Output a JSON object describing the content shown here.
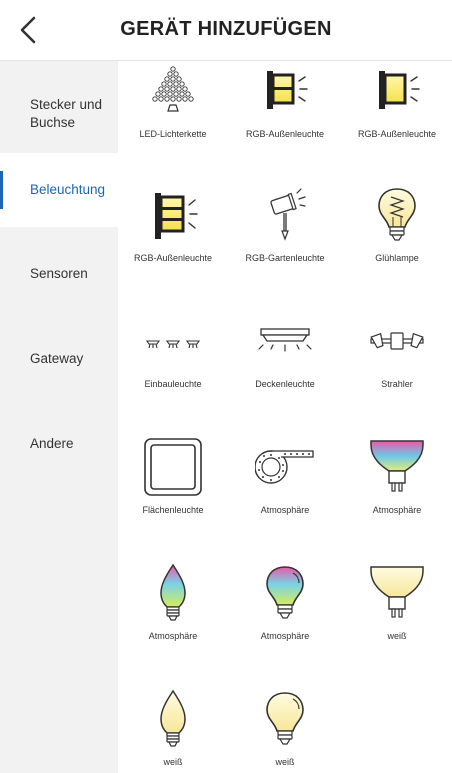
{
  "header": {
    "title": "GERÄT HINZUFÜGEN",
    "back_icon": "chevron-left-icon"
  },
  "sidebar": {
    "active_color": "#1a66b8",
    "items": [
      {
        "label": "Stecker und\nBuchse",
        "active": false
      },
      {
        "label": "Beleuchtung",
        "active": true
      },
      {
        "label": "Sensoren",
        "active": false
      },
      {
        "label": "Gateway",
        "active": false
      },
      {
        "label": "Andere",
        "active": false
      }
    ]
  },
  "devices": [
    {
      "label": "LED-Lichterkette",
      "icon": "led-string-lights-icon"
    },
    {
      "label": "RGB-Außenleuchte",
      "icon": "outdoor-light-icon"
    },
    {
      "label": "RGB-Außenleuchte",
      "icon": "outdoor-light-icon"
    },
    {
      "label": "RGB-Außenleuchte",
      "icon": "outdoor-light-icon"
    },
    {
      "label": "RGB-Gartenleuchte",
      "icon": "garden-spotlight-icon"
    },
    {
      "label": "Glühlampe",
      "icon": "filament-bulb-icon"
    },
    {
      "label": "Einbauleuchte",
      "icon": "recessed-light-icon"
    },
    {
      "label": "Deckenleuchte",
      "icon": "ceiling-light-icon"
    },
    {
      "label": "Strahler",
      "icon": "spotlight-bar-icon"
    },
    {
      "label": "Flächenleuchte",
      "icon": "panel-light-icon"
    },
    {
      "label": "Atmosphäre",
      "icon": "light-strip-icon"
    },
    {
      "label": "Atmosphäre",
      "icon": "rgb-spot-bulb-icon"
    },
    {
      "label": "Atmosphäre",
      "icon": "rgb-candle-bulb-icon"
    },
    {
      "label": "Atmosphäre",
      "icon": "rgb-bulb-icon"
    },
    {
      "label": "weiß",
      "icon": "white-spot-bulb-icon"
    },
    {
      "label": "weiß",
      "icon": "white-candle-bulb-icon"
    },
    {
      "label": "weiß",
      "icon": "white-bulb-icon"
    }
  ]
}
